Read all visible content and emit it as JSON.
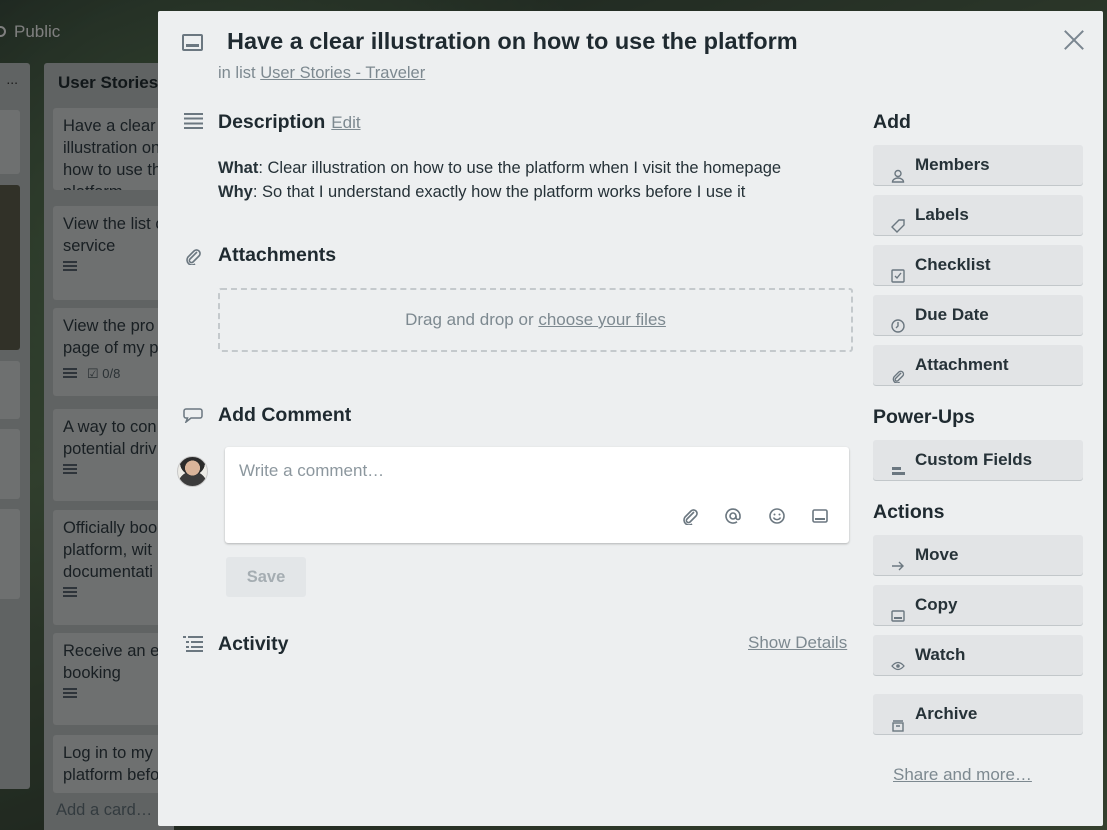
{
  "board": {
    "visibility": "Public",
    "list_more": "...",
    "list_title": "User Stories",
    "cards": [
      {
        "text": "Have a clear illustration on how to use the platform",
        "checklist": ""
      },
      {
        "text": "View the list of service",
        "checklist": ""
      },
      {
        "text": "View the pro page of my p",
        "checklist": "0/8"
      },
      {
        "text": "A way to con potential driv",
        "checklist": ""
      },
      {
        "text": "Officially boo platform, wit documentati",
        "checklist": ""
      },
      {
        "text": "Receive an e booking",
        "checklist": ""
      },
      {
        "text": "Log in to my platform befo",
        "checklist": ""
      }
    ],
    "add_card": "Add a card…"
  },
  "modal": {
    "title": "Have a clear illustration on how to use the platform",
    "in_list_prefix": "in list",
    "list_name": "User Stories - Traveler",
    "description": {
      "heading": "Description",
      "edit": "Edit",
      "what_label": "What",
      "what_text": ": Clear illustration on how to use the platform when I visit the homepage",
      "why_label": "Why",
      "why_text": ": So that I understand exactly how the platform works before I use it"
    },
    "attachments": {
      "heading": "Attachments",
      "drop_text": "Drag and drop or ",
      "choose_link": "choose your files"
    },
    "comment": {
      "heading": "Add Comment",
      "placeholder": "Write a comment…",
      "save": "Save"
    },
    "activity": {
      "heading": "Activity",
      "show_details": "Show Details"
    },
    "sidebar": {
      "add_heading": "Add",
      "add_buttons": [
        "Members",
        "Labels",
        "Checklist",
        "Due Date",
        "Attachment"
      ],
      "powerups_heading": "Power-Ups",
      "powerups_buttons": [
        "Custom Fields"
      ],
      "actions_heading": "Actions",
      "actions_buttons": [
        "Move",
        "Copy",
        "Watch",
        "Archive"
      ],
      "share": "Share and more…"
    }
  },
  "colors": {
    "modal_bg": "#edeff0",
    "button_bg": "#e2e4e6",
    "muted_text": "#7d8990",
    "heading_text": "#1f2a30"
  }
}
